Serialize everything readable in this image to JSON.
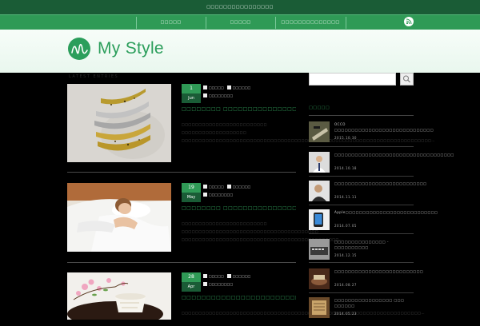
{
  "topbar": {
    "tagline": "□□□□□□□□□□□□□□□□"
  },
  "nav": {
    "items": [
      {
        "label": "□□□□□"
      },
      {
        "label": "□□□□□"
      },
      {
        "label": "□□□□□□□□□□□□□□"
      }
    ],
    "rss_icon": "rss-icon"
  },
  "header": {
    "logo_text": "My Style",
    "logo_icon": "logo-mark-icon"
  },
  "main": {
    "section_label": "LATEST ENTRIES",
    "posts": [
      {
        "day": "1",
        "month": "Jun",
        "meta_line1": "□□□□□",
        "meta_line2": "□□□□□□",
        "category": "□□□□□□□□",
        "title": "□□□□□□□□ □□□□□□□□□□□□□□□□□□□",
        "excerpt": "□□□□□□□□□□□□□□□□□□□□□□□□□ □□□□□□□□□□□□□□□□□□□ □□□□□□□□□□□□□□□□□□□□□□□□□□□□□□□□□□□□□□□□□□□□□□□□□□□□□□□□□□□□□□□□□□□□□□□□□…"
      },
      {
        "day": "19",
        "month": "May",
        "meta_line1": "□□□□□",
        "meta_line2": "□□□□□□",
        "category": "□□□□□□□□",
        "title": "□□□□□□□□ □□□□□□□□□□□□□□□□",
        "excerpt": "□□□□□□□□□□□□□□□□□□□□□□□□□ □□□□□□□□□□□□□□□□□□□□□□□□□□□□□□□□□□□□□□□□ □□□□□□□□□□□□□□□□□□□□□□□□□□□□□□□□□□□□□□□□□□□□□□…"
      },
      {
        "day": "28",
        "month": "Apr",
        "meta_line1": "□□□□□",
        "meta_line2": "□□□□□□",
        "category": "□□□□□□□□",
        "title": "□□□□□□□□□□□□□□□□□□□□□□□□□□□□□□",
        "excerpt": "□□□□□□□□□□□□□□□□□□□□□□□□□□□□□□□□□□□□□□□□□□□□□□□□□□□□□□□□□□□□□□□□□□□□□□…"
      }
    ]
  },
  "sidebar": {
    "search_placeholder": "",
    "search_icon": "search-icon",
    "popular_heading": "□□□□□",
    "items": [
      {
        "title": "OCCO □□□□□□□□□□□□□□□□□□□□□□□□□□□□□",
        "date": "2015.10.30"
      },
      {
        "title": "□□□□□□□□□□□□□□□□□□□□□□□□□□□□□□□□□□□",
        "date": "2014.10.18"
      },
      {
        "title": "□□□□□□□□□□□□□□□□□□□□□□□□□□□",
        "date": "2014.11.11"
      },
      {
        "title": "Apple□□□□□□□□□□□□□□□□□□□□□□□□□□□",
        "date": "2014.07.05"
      },
      {
        "title": "□□□□□□□□□□□□□□□ - □□□□□□□□□□",
        "date": "2014.12.15"
      },
      {
        "title": "□□□□□□□□□□□□□□□□□□□□□□□□□□",
        "date": "2014.08.27"
      },
      {
        "title": "□□□□□□□□□□□□□□□□□ □□□ □□□□□□",
        "date": "2014.05.23"
      }
    ]
  },
  "colors": {
    "accent": "#2f9a56",
    "accent_dark": "#1a5c36",
    "background": "#000000"
  }
}
